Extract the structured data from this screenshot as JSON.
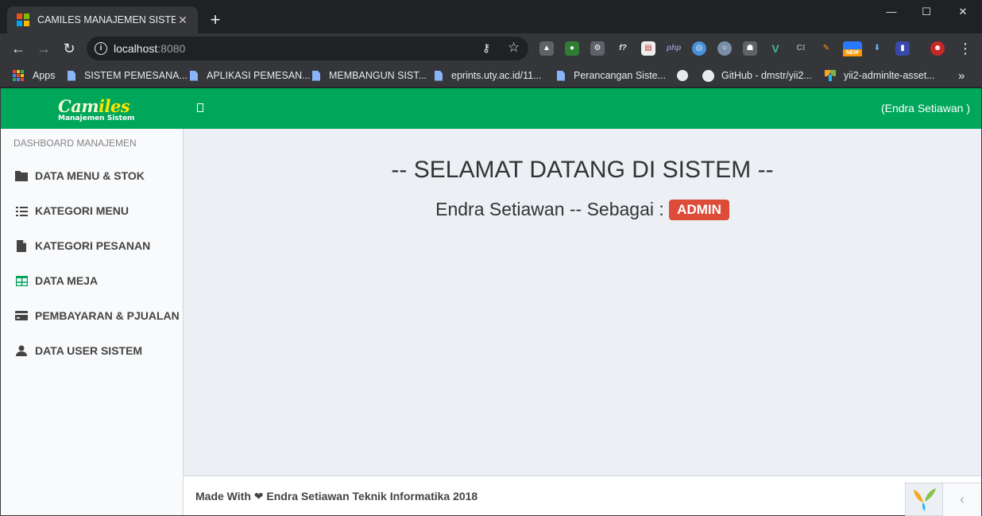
{
  "browser": {
    "tab_title": "CAMILES MANAJEMEN SISTEM",
    "tab_close": "✕",
    "new_tab": "+",
    "window_controls": {
      "minimize": "—",
      "maximize": "☐",
      "close": "✕"
    },
    "url_host": "localhost",
    "url_port": ":8080",
    "bookmarks": [
      {
        "label": "Apps",
        "icon": "apps-grid-icon"
      },
      {
        "label": "SISTEM PEMESANA...",
        "icon": "document-icon"
      },
      {
        "label": "APLIKASI PEMESAN...",
        "icon": "document-icon"
      },
      {
        "label": "MEMBANGUN SIST...",
        "icon": "document-icon"
      },
      {
        "label": "eprints.uty.ac.id/11...",
        "icon": "document-icon"
      },
      {
        "label": "Perancangan Siste...",
        "icon": "document-icon"
      },
      {
        "label": "",
        "icon": "globe-icon"
      },
      {
        "label": "GitHub - dmstr/yii2...",
        "icon": "github-icon"
      },
      {
        "label": "yii2-adminlte-asset...",
        "icon": "yii-icon"
      }
    ],
    "bookmarks_overflow": "»",
    "extension_badge": "NEW"
  },
  "app": {
    "logo_main_a": "Cam",
    "logo_main_b": "iles",
    "logo_sub": "Manajemen Sistem",
    "user_label": "(Endra Setiawan )",
    "sidebar_header": "DASHBOARD MANAJEMEN",
    "menu": [
      {
        "label": "DATA MENU & STOK",
        "icon": "folder-icon"
      },
      {
        "label": "KATEGORI MENU",
        "icon": "list-icon"
      },
      {
        "label": "KATEGORI PESANAN",
        "icon": "file-icon"
      },
      {
        "label": "DATA MEJA",
        "icon": "table-icon"
      },
      {
        "label": "PEMBAYARAN & PJUALAN",
        "icon": "credit-card-icon"
      },
      {
        "label": "DATA USER SISTEM",
        "icon": "user-icon"
      }
    ],
    "welcome_title": "-- SELAMAT DATANG DI SISTEM --",
    "welcome_user": "Endra Setiawan -- Sebagai : ",
    "role": "ADMIN",
    "footer_text": "Made With ❤ Endra Setiawan Teknik Informatika 2018",
    "collapse_glyph": "‹"
  },
  "colors": {
    "header_green": "#00a65a",
    "badge_red": "#dd4b39",
    "content_bg": "#ecf0f5",
    "sidebar_bg": "#f9fafc"
  }
}
